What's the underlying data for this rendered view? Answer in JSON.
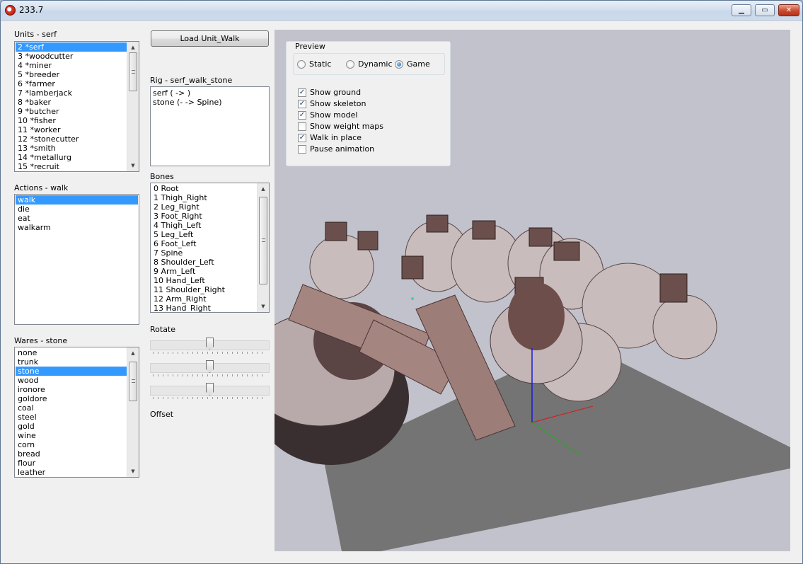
{
  "window": {
    "title": "233.7"
  },
  "units": {
    "label": "Units - serf",
    "items": [
      "2 *serf",
      "3 *woodcutter",
      "4 *miner",
      "5 *breeder",
      "6 *farmer",
      "7 *lamberjack",
      "8 *baker",
      "9 *butcher",
      "10 *fisher",
      "11 *worker",
      "12 *stonecutter",
      "13 *smith",
      "14 *metallurg",
      "15 *recruit"
    ],
    "selected": 0
  },
  "actions": {
    "label": "Actions - walk",
    "items": [
      "walk",
      "die",
      "eat",
      "walkarm"
    ],
    "selected": 0
  },
  "wares": {
    "label": "Wares - stone",
    "items": [
      "none",
      "trunk",
      "stone",
      "wood",
      "ironore",
      "goldore",
      "coal",
      "steel",
      "gold",
      "wine",
      "corn",
      "bread",
      "flour",
      "leather"
    ],
    "selected": 2
  },
  "load_button": "Load Unit_Walk",
  "rig": {
    "label": "Rig - serf_walk_stone",
    "lines": [
      "serf ( -> )",
      "stone (- -> Spine)"
    ]
  },
  "bones": {
    "label": "Bones",
    "items": [
      "0 Root",
      "1 Thigh_Right",
      "2 Leg_Right",
      "3 Foot_Right",
      "4 Thigh_Left",
      "5 Leg_Left",
      "6 Foot_Left",
      "7 Spine",
      "8 Shoulder_Left",
      "9 Arm_Left",
      "10 Hand_Left",
      "11 Shoulder_Right",
      "12 Arm_Right",
      "13 Hand_Right"
    ]
  },
  "rotate": {
    "label": "Rotate",
    "sliders": [
      0.5,
      0.5,
      0.5
    ]
  },
  "offset": {
    "label": "Offset"
  },
  "preview": {
    "title": "Preview",
    "modes": [
      "Static",
      "Dynamic",
      "Game"
    ],
    "selected_mode": 2,
    "options": [
      {
        "label": "Show ground",
        "checked": true
      },
      {
        "label": "Show skeleton",
        "checked": true
      },
      {
        "label": "Show model",
        "checked": true
      },
      {
        "label": "Show weight maps",
        "checked": false
      },
      {
        "label": "Walk in place",
        "checked": true
      },
      {
        "label": "Pause animation",
        "checked": false
      }
    ]
  },
  "colors": {
    "selection": "#3399ff",
    "viewport_bg": "#c2c2cc",
    "ground": "#747474"
  },
  "icons": {
    "app": "app-icon",
    "minimize": "minimize-icon",
    "maximize": "maximize-icon",
    "close": "close-icon",
    "scroll_up": "scroll-up-icon",
    "scroll_down": "scroll-down-icon"
  }
}
